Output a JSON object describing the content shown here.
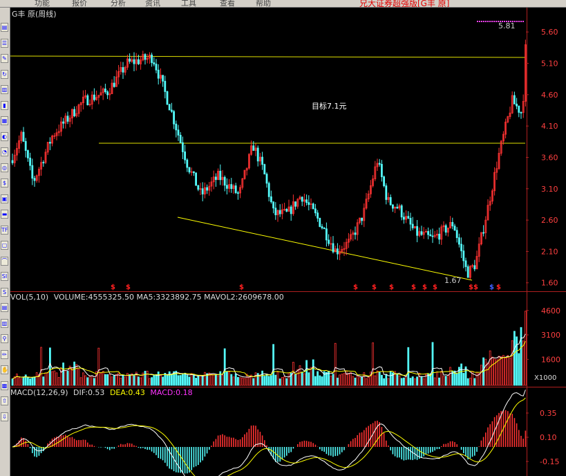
{
  "menu": {
    "items": [
      "",
      "功能",
      "报价",
      "分析",
      "资讯",
      "工具",
      "查看",
      "帮助",
      ""
    ],
    "app_title": "兄大证券超强版[G丰  原]"
  },
  "toolbar": {
    "icons": [
      {
        "name": "menu-icon",
        "glyph": "▤"
      },
      {
        "name": "list-icon",
        "glyph": "☰"
      },
      {
        "name": "edit-icon",
        "glyph": "✎"
      },
      {
        "name": "refresh-icon",
        "glyph": "↻"
      },
      {
        "name": "page-icon",
        "glyph": "▥"
      },
      {
        "name": "bars-icon",
        "glyph": "▮"
      },
      {
        "name": "grid-icon",
        "glyph": "▦"
      },
      {
        "name": "bulb-icon",
        "glyph": "◐"
      },
      {
        "name": "chart-icon",
        "glyph": "◔"
      },
      {
        "name": "target-icon",
        "glyph": "◎"
      },
      {
        "name": "dollar-icon",
        "glyph": "$"
      },
      {
        "name": "block-icon",
        "glyph": "▣"
      },
      {
        "name": "line-icon",
        "glyph": "▬"
      },
      {
        "name": "tf-icon",
        "glyph": "TF"
      },
      {
        "name": "square-icon",
        "glyph": "▢"
      },
      {
        "name": "curve-icon",
        "glyph": "⌒"
      },
      {
        "name": "si-icon",
        "glyph": "SI"
      },
      {
        "name": "s-icon",
        "glyph": "S"
      },
      {
        "name": "table-icon",
        "glyph": "▤"
      },
      {
        "name": "table2-icon",
        "glyph": "▥"
      },
      {
        "name": "pin-icon",
        "glyph": "⚲"
      },
      {
        "name": "pencil-icon",
        "glyph": "✏"
      },
      {
        "name": "hand-icon",
        "glyph": "✋"
      },
      {
        "name": "box-icon",
        "glyph": "▩"
      },
      {
        "name": "arrow-up-icon",
        "glyph": "⇧"
      },
      {
        "name": "arrow-down-icon",
        "glyph": "⇩"
      }
    ]
  },
  "chart_data": [
    {
      "type": "candlestick",
      "header": "G丰  原(周线)",
      "y_ticks": [
        "5.60",
        "5.10",
        "4.60",
        "4.10",
        "3.60",
        "3.10",
        "2.60",
        "2.10",
        "1.60"
      ],
      "y_tick_values": [
        5.6,
        5.1,
        4.6,
        4.1,
        3.6,
        3.1,
        2.6,
        2.1,
        1.6
      ],
      "ylim": [
        1.52,
        5.9
      ],
      "annotations": {
        "high": "5.81",
        "low": "1.67",
        "target": "目标7.1元"
      },
      "signal_marker": "$",
      "colors": {
        "up": "#ff3232",
        "down": "#54fcfc",
        "trendline": "#ffff00",
        "hline": "#e0e000"
      }
    },
    {
      "type": "bar",
      "header_name": "VOL(5,10)",
      "header_values": "VOLUME:4555325.50  MA5:3323892.75  MAVOL2:2609678.00",
      "y_ticks": [
        "4600",
        "3100",
        "1600"
      ],
      "y_tick_values": [
        4600,
        3100,
        1600
      ],
      "unit_label": "X1000",
      "ylim": [
        0,
        5100
      ]
    },
    {
      "type": "bar",
      "header_name": "MACD(12,26,9)",
      "dif": "DIF:0.53",
      "dea": "DEA:0.43",
      "macd": "MACD:0.18",
      "y_ticks": [
        "0.35",
        "0.10",
        "-0.15"
      ],
      "y_tick_values": [
        0.35,
        0.1,
        -0.15
      ],
      "ylim": [
        -0.3,
        0.55
      ]
    }
  ]
}
